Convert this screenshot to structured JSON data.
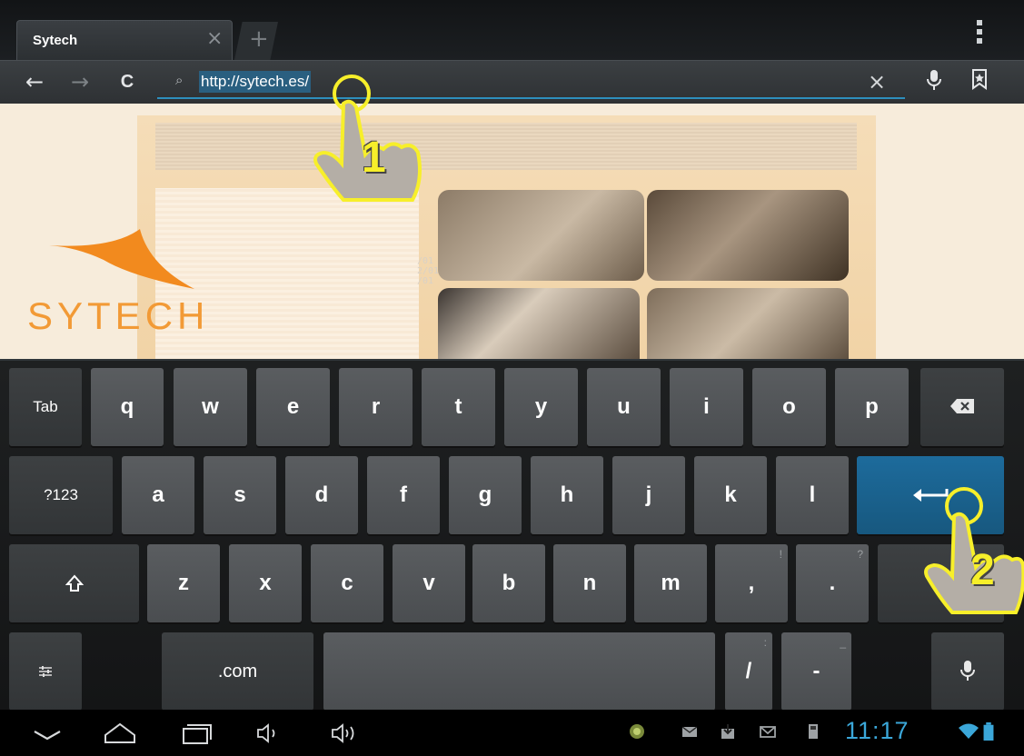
{
  "browser": {
    "tab": {
      "title": "Sytech",
      "close_glyph": "×"
    },
    "new_tab_glyph": "+",
    "toolbar": {
      "back_glyph": "←",
      "forward_glyph": "→",
      "reload_glyph": "C",
      "url_value": "http://sytech.es/",
      "clear_glyph": "×"
    }
  },
  "website": {
    "logo_text": "SYTECH",
    "overlay_text": "/01\n2/01\n/01"
  },
  "keyboard": {
    "row1": [
      "Tab",
      "q",
      "w",
      "e",
      "r",
      "t",
      "y",
      "u",
      "i",
      "o",
      "p"
    ],
    "row2": [
      "?123",
      "a",
      "s",
      "d",
      "f",
      "g",
      "h",
      "j",
      "k",
      "l"
    ],
    "row3": [
      "z",
      "x",
      "c",
      "v",
      "b",
      "n",
      "m",
      ",",
      "."
    ],
    "row3_hints": {
      "comma": "!",
      "period": "?"
    },
    "row4": {
      "dotcom": ".com",
      "slash": "/",
      "slash_hint": ":",
      "dash": "-",
      "dash_hint": "_"
    }
  },
  "status_bar": {
    "time": "11:17"
  },
  "annotations": {
    "step1": "1",
    "step2": "2"
  },
  "colors": {
    "accent": "#2d8fbd",
    "enter_key": "#1d6b9c",
    "callout": "#f7ef2a",
    "logo": "#f29a36",
    "clock": "#3ba7d9"
  }
}
